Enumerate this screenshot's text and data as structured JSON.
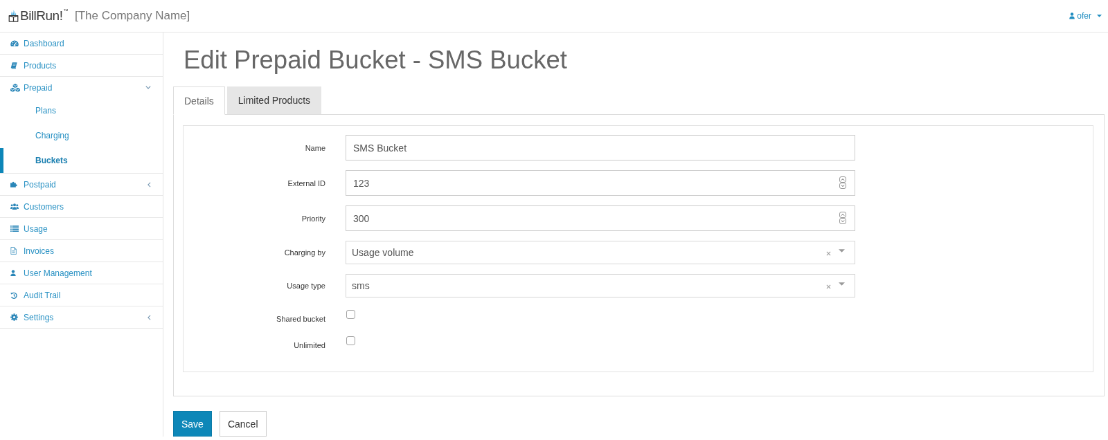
{
  "header": {
    "logo": "BillRun!$^{™}$",
    "company": "[The Company Name]",
    "user": "ofer"
  },
  "sidebar": {
    "items": [
      {
        "label": "Dashboard",
        "selected": false
      },
      {
        "label": "Products",
        "selected": false
      },
      {
        "label": "Prepaid",
        "selected": false,
        "expanded": true,
        "children": [
          {
            "label": "Plans",
            "selected": false
          },
          {
            "label": "Charging",
            "selected": false
          },
          {
            "label": "Buckets",
            "selected": true
          }
        ]
      },
      {
        "label": "Postpaid",
        "selected": false,
        "expanded": false
      },
      {
        "label": "Customers",
        "selected": false
      },
      {
        "label": "Usage",
        "selected": false
      },
      {
        "label": "Invoices",
        "selected": false
      },
      {
        "label": "User Management",
        "selected": false
      },
      {
        "label": "Audit Trail",
        "selected": false
      },
      {
        "label": "Settings",
        "selected": false,
        "expanded": false
      }
    ]
  },
  "page": {
    "title": "Edit Prepaid Bucket - SMS Bucket"
  },
  "tabs": [
    {
      "label": "Details",
      "selected": true
    },
    {
      "label": "Limited Products",
      "selected": false
    }
  ],
  "form": {
    "fields": [
      {
        "kind": "text",
        "label": "Name",
        "value": "SMS Bucket"
      },
      {
        "kind": "number",
        "label": "External ID",
        "value": "123"
      },
      {
        "kind": "number",
        "label": "Priority",
        "value": "300"
      },
      {
        "kind": "select",
        "label": "Charging by",
        "value": "Usage volume"
      },
      {
        "kind": "select",
        "label": "Usage type",
        "value": "sms"
      },
      {
        "kind": "checkbox",
        "label": "Shared bucket",
        "checked": false
      },
      {
        "kind": "checkbox",
        "label": "Unlimited",
        "checked": false
      }
    ]
  },
  "buttons": [
    {
      "label": "Save",
      "kind": "primary"
    },
    {
      "label": "Cancel",
      "kind": "default"
    }
  ]
}
